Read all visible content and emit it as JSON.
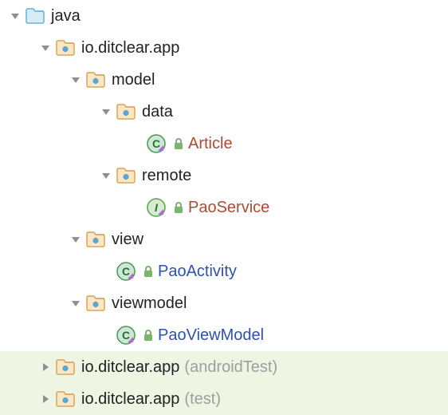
{
  "tree": {
    "java": "java",
    "pkg_main": "io.ditclear.app",
    "model": "model",
    "data": "data",
    "article": "Article",
    "remote": "remote",
    "paoservice": "PaoService",
    "view": "view",
    "paoactivity": "PaoActivity",
    "viewmodel": "viewmodel",
    "paoviewmodel": "PaoViewModel",
    "pkg_androidtest": "io.ditclear.app",
    "pkg_androidtest_hint": "(androidTest)",
    "pkg_test": "io.ditclear.app",
    "pkg_test_hint": "(test)"
  }
}
